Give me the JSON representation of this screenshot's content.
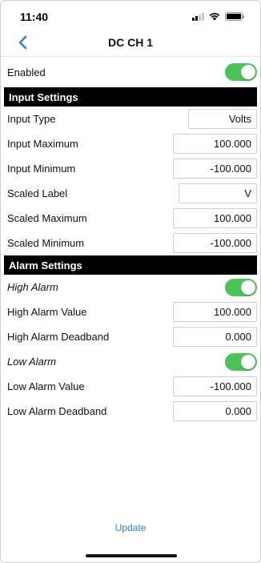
{
  "status": {
    "time": "11:40"
  },
  "nav": {
    "title": "DC CH 1",
    "back_icon": "chevron-left-icon",
    "accent": "#2f7fd8"
  },
  "enabled": {
    "label": "Enabled",
    "on": true
  },
  "input_settings": {
    "header": "Input Settings",
    "input_type": {
      "label": "Input Type",
      "value": "Volts"
    },
    "input_maximum": {
      "label": "Input Maximum",
      "value": "100.000"
    },
    "input_minimum": {
      "label": "Input Minimum",
      "value": "-100.000"
    },
    "scaled_label": {
      "label": "Scaled Label",
      "value": "V"
    },
    "scaled_maximum": {
      "label": "Scaled Maximum",
      "value": "100.000"
    },
    "scaled_minimum": {
      "label": "Scaled Minimum",
      "value": "-100.000"
    }
  },
  "alarm_settings": {
    "header": "Alarm Settings",
    "high_alarm": {
      "label": "High Alarm",
      "on": true
    },
    "high_alarm_value": {
      "label": "High Alarm Value",
      "value": "100.000"
    },
    "high_alarm_deadband": {
      "label": "High Alarm Deadband",
      "value": "0.000"
    },
    "low_alarm": {
      "label": "Low Alarm",
      "on": true
    },
    "low_alarm_value": {
      "label": "Low Alarm Value",
      "value": "-100.000"
    },
    "low_alarm_deadband": {
      "label": "Low Alarm Deadband",
      "value": "0.000"
    }
  },
  "footer": {
    "update_label": "Update"
  },
  "colors": {
    "toggle_on": "#4cc35a",
    "section_header_bg": "#000000"
  }
}
